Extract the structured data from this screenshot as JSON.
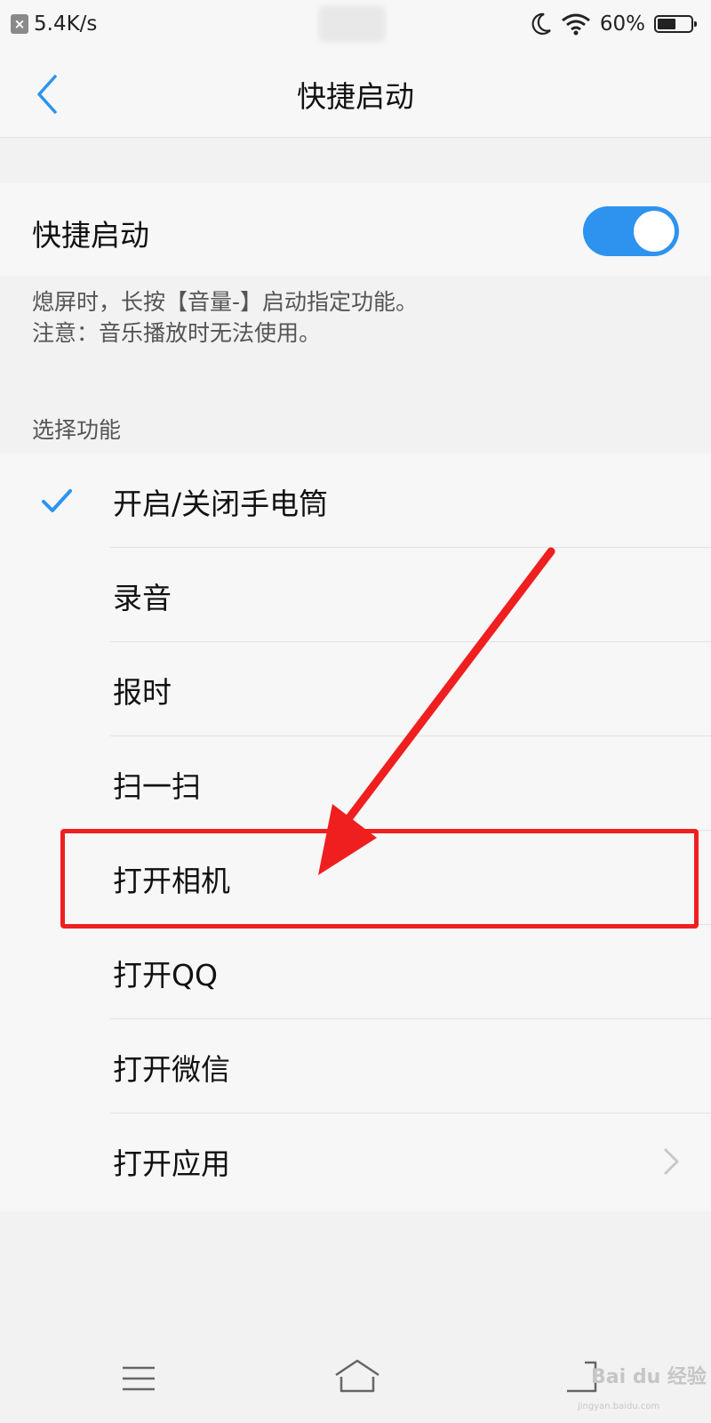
{
  "status_bar": {
    "notification_icon": "close-box-icon",
    "network_speed": "5.4K/s",
    "icons": [
      "moon-icon",
      "wifi-icon",
      "battery-icon"
    ],
    "battery_percent": "60%",
    "battery_level": 0.6
  },
  "header": {
    "back_icon": "chevron-left-icon",
    "title": "快捷启动"
  },
  "quick_launch": {
    "label": "快捷启动",
    "enabled": true,
    "accent_color": "#2d93ee",
    "description_line1": "熄屏时，长按【音量-】启动指定功能。",
    "description_line2": "注意：音乐播放时无法使用。"
  },
  "function_section": {
    "header": "选择功能",
    "items": [
      {
        "label": "开启/关闭手电筒",
        "selected": true
      },
      {
        "label": "录音"
      },
      {
        "label": "报时"
      },
      {
        "label": "扫一扫"
      },
      {
        "label": "打开相机",
        "highlighted": true
      },
      {
        "label": "打开QQ"
      },
      {
        "label": "打开微信"
      },
      {
        "label": "打开应用",
        "has_chevron": true
      }
    ]
  },
  "annotation": {
    "color": "#ef1f1f",
    "arrow_icon": "red-arrow",
    "highlight": "打开相机"
  },
  "nav_bar": {
    "icons": [
      "menu-icon",
      "home-icon",
      "back-icon"
    ]
  },
  "watermark": {
    "text": "Bai du 经验",
    "sub": "jingyan.baidu.com"
  }
}
